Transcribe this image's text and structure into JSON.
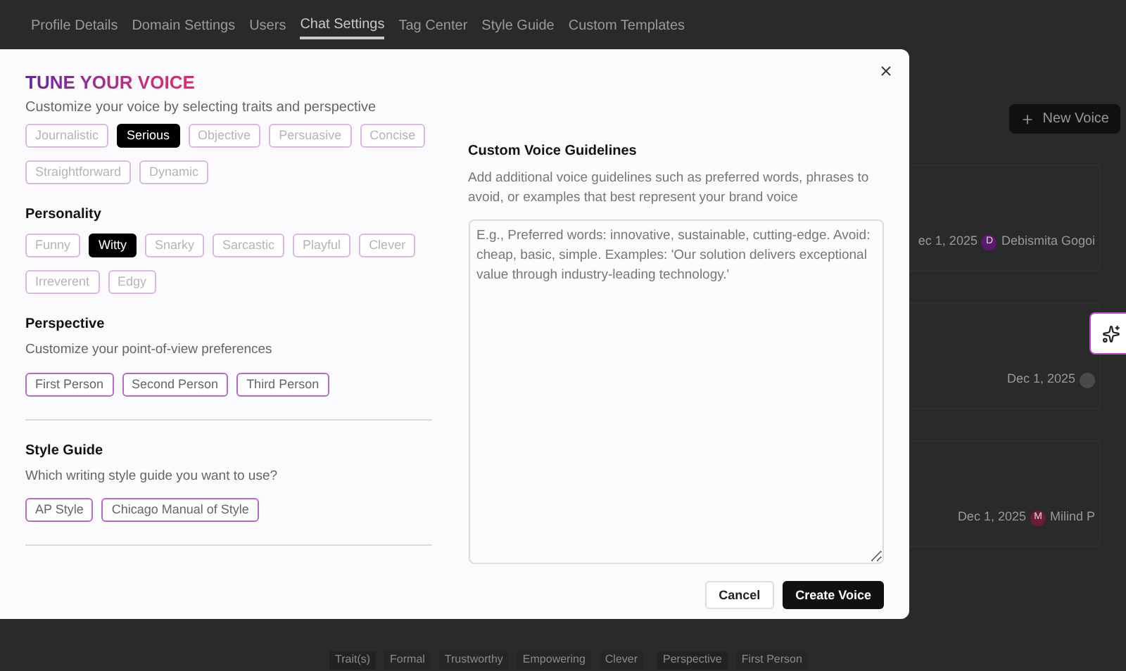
{
  "nav_tabs": [
    {
      "label": "Profile Details",
      "selected": false
    },
    {
      "label": "Domain Settings",
      "selected": false
    },
    {
      "label": "Users",
      "selected": false
    },
    {
      "label": "Chat Settings",
      "selected": true
    },
    {
      "label": "Tag Center",
      "selected": false
    },
    {
      "label": "Style Guide",
      "selected": false
    },
    {
      "label": "Custom Templates",
      "selected": false
    }
  ],
  "new_voice_button": "New Voice",
  "voice_cards": [
    {
      "date": "ec 1, 2025",
      "author": "Debismita Gogoi",
      "avatar_initial": "D",
      "color": "#5b1a6e"
    },
    {
      "date": "Dec 1, 2025",
      "color": "#4a4a4a"
    },
    {
      "date": "Dec 1, 2025",
      "author": "Milind P",
      "avatar_initial": "M",
      "color": "#6e1a3a"
    }
  ],
  "tags_row": [
    {
      "label": "Trait(s)",
      "kind": "heading"
    },
    {
      "label": "Formal",
      "kind": "tag"
    },
    {
      "label": "Trustworthy",
      "kind": "tag"
    },
    {
      "label": "Empowering",
      "kind": "tag"
    },
    {
      "label": "Clever",
      "kind": "tag"
    },
    {
      "label": "Perspective",
      "kind": "heading"
    },
    {
      "label": "First Person",
      "kind": "tag"
    }
  ],
  "modal": {
    "title": "TUNE YOUR VOICE",
    "subtitle": "Customize your voice by selecting traits and perspective",
    "sections": [
      {
        "kind": "trait",
        "options": [
          {
            "label": "Journalistic",
            "selected": false
          },
          {
            "label": "Serious",
            "selected": true
          },
          {
            "label": "Objective",
            "selected": false
          },
          {
            "label": "Persuasive",
            "selected": false
          },
          {
            "label": "Concise",
            "selected": false
          },
          {
            "label": "Straightforward",
            "selected": false
          },
          {
            "label": "Dynamic",
            "selected": false
          }
        ]
      },
      {
        "title": "Personality",
        "kind": "trait",
        "options": [
          {
            "label": "Funny",
            "selected": false
          },
          {
            "label": "Witty",
            "selected": true
          },
          {
            "label": "Snarky",
            "selected": false
          },
          {
            "label": "Sarcastic",
            "selected": false
          },
          {
            "label": "Playful",
            "selected": false
          },
          {
            "label": "Clever",
            "selected": false
          },
          {
            "label": "Irreverent",
            "selected": false
          },
          {
            "label": "Edgy",
            "selected": false
          }
        ]
      },
      {
        "title": "Perspective",
        "description": "Customize your point-of-view preferences",
        "kind": "choice",
        "options": [
          {
            "label": "First Person",
            "selected": false
          },
          {
            "label": "Second Person",
            "selected": false
          },
          {
            "label": "Third Person",
            "selected": false
          }
        ]
      },
      {
        "title": "Style Guide",
        "description": "Which writing style guide you want to use?",
        "kind": "choice",
        "options": [
          {
            "label": "AP Style",
            "selected": false
          },
          {
            "label": "Chicago Manual of Style",
            "selected": false
          }
        ]
      }
    ],
    "guidelines": {
      "title": "Custom Voice Guidelines",
      "description": "Add additional voice guidelines such as preferred words, phrases to avoid, or examples that best represent your brand voice",
      "placeholder": "E.g., Preferred words: innovative, sustainable, cutting-edge. Avoid: cheap, basic, simple. Examples: 'Our solution delivers exceptional value through industry-leading technology.'"
    },
    "cancel_button": "Cancel",
    "create_button": "Create Voice"
  }
}
